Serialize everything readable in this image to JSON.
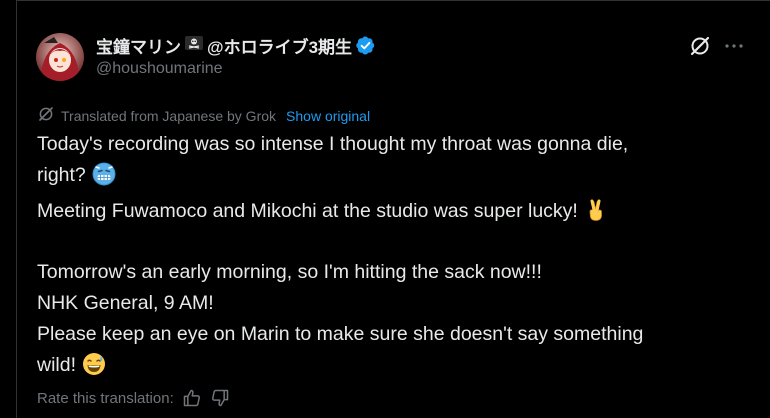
{
  "author": {
    "display_name": "宝鐘マリン🏴‍☠️@ホロライブ3期生",
    "name_main": "宝鐘マリン",
    "name_suffix": "@ホロライブ3期生",
    "handle": "@houshoumarine",
    "verified_icon": "verified-badge-icon"
  },
  "translation": {
    "notice": "Translated from Japanese by Grok",
    "show_original": "Show original",
    "icon": "grok-icon"
  },
  "tweet": {
    "lines": [
      "Today's recording was so intense I thought my throat was gonna die,",
      "right?",
      "Meeting Fuwamoco and Mikochi at the studio was super lucky!",
      "",
      "Tomorrow's an early morning, so I'm hitting the sack now!!!",
      "NHK General, 9 AM!",
      "Please keep an eye on Marin to make sure she doesn't say something",
      "wild!"
    ],
    "emojis": [
      "cold-face-emoji",
      "victory-hand-emoji",
      "grinning-sweat-emoji"
    ]
  },
  "rating": {
    "label": "Rate this translation:",
    "icons": [
      "thumbs-up-icon",
      "thumbs-down-icon"
    ]
  },
  "colors": {
    "background": "#000000",
    "text": "#e7e9ea",
    "muted": "#71767b",
    "link": "#1d9bf0",
    "border": "#2f3336"
  }
}
